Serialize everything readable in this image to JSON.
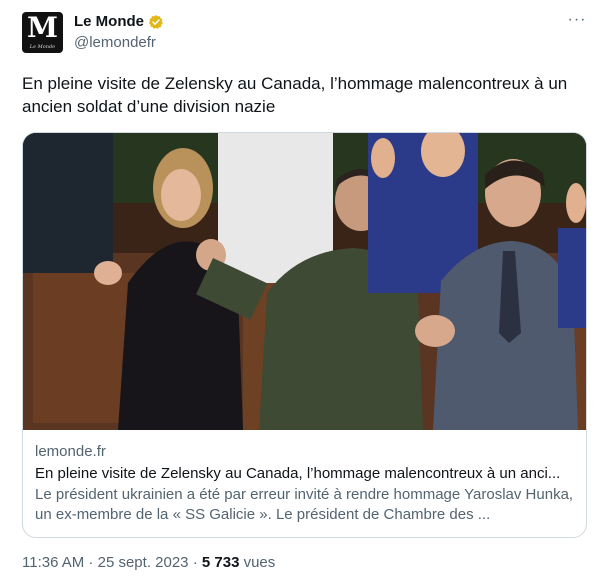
{
  "author": {
    "display_name": "Le Monde",
    "handle": "@lemondefr",
    "avatar_letter": "M",
    "avatar_wordmark": "Le Monde",
    "verified_color": "#e2b719"
  },
  "tweet": {
    "text": "En pleine visite de Zelensky au Canada, l’hommage malencontreux à un ancien soldat d’une division nazie"
  },
  "more_menu": {
    "label": "···"
  },
  "card": {
    "domain": "lemonde.fr",
    "title": "En pleine visite de Zelensky au Canada, l’hommage malencontreux à un anci...",
    "description": "Le président ukrainien a été par erreur invité à rendre hommage Yaroslav Hunka, un ex-membre de la « SS Galicie ». Le président de Chambre des ..."
  },
  "meta": {
    "time": "11:36 AM",
    "separator1": " · ",
    "date": "25 sept. 2023",
    "separator2": " · ",
    "views_count": "5 733",
    "views_label": " vues"
  },
  "colors": {
    "text_primary": "#0f1419",
    "text_secondary": "#536471",
    "border": "#cfd9de"
  }
}
